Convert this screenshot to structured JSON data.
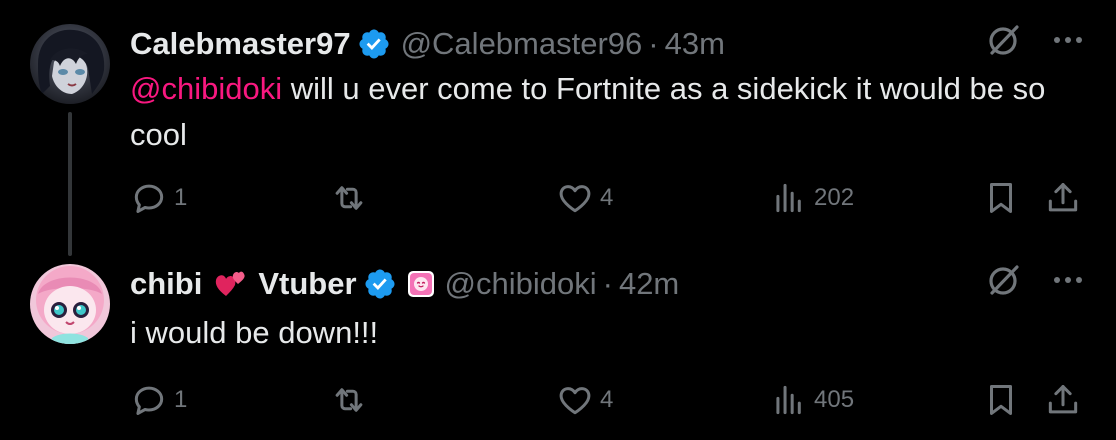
{
  "tweets": [
    {
      "display_name": "Calebmaster97",
      "handle": "@Calebmaster96",
      "separator": "·",
      "time": "43m",
      "mention": "@chibidoki",
      "text": " will u ever come to Fortnite as a sidekick it would be so cool",
      "replies": "1",
      "likes": "4",
      "views": "202"
    },
    {
      "display_name_first": "chibi",
      "display_name_second": "Vtuber",
      "handle": "@chibidoki",
      "separator": "·",
      "time": "42m",
      "text": "i would be down!!!",
      "replies": "1",
      "likes": "4",
      "views": "405"
    }
  ],
  "colors": {
    "background": "#000000",
    "text": "#e7e9ea",
    "muted": "#71767b",
    "mention": "#f91880",
    "verified": "#1d9bf0",
    "thread_line": "#333639"
  },
  "icons": {
    "verified": "verified-badge-icon",
    "reply": "reply-icon",
    "retweet": "retweet-icon",
    "like": "heart-icon",
    "views": "views-icon",
    "bookmark": "bookmark-icon",
    "share": "share-icon",
    "grok": "grok-icon",
    "more": "more-icon",
    "emoji": "two-hearts-emoji-icon",
    "affiliation": "affiliation-badge-icon"
  }
}
